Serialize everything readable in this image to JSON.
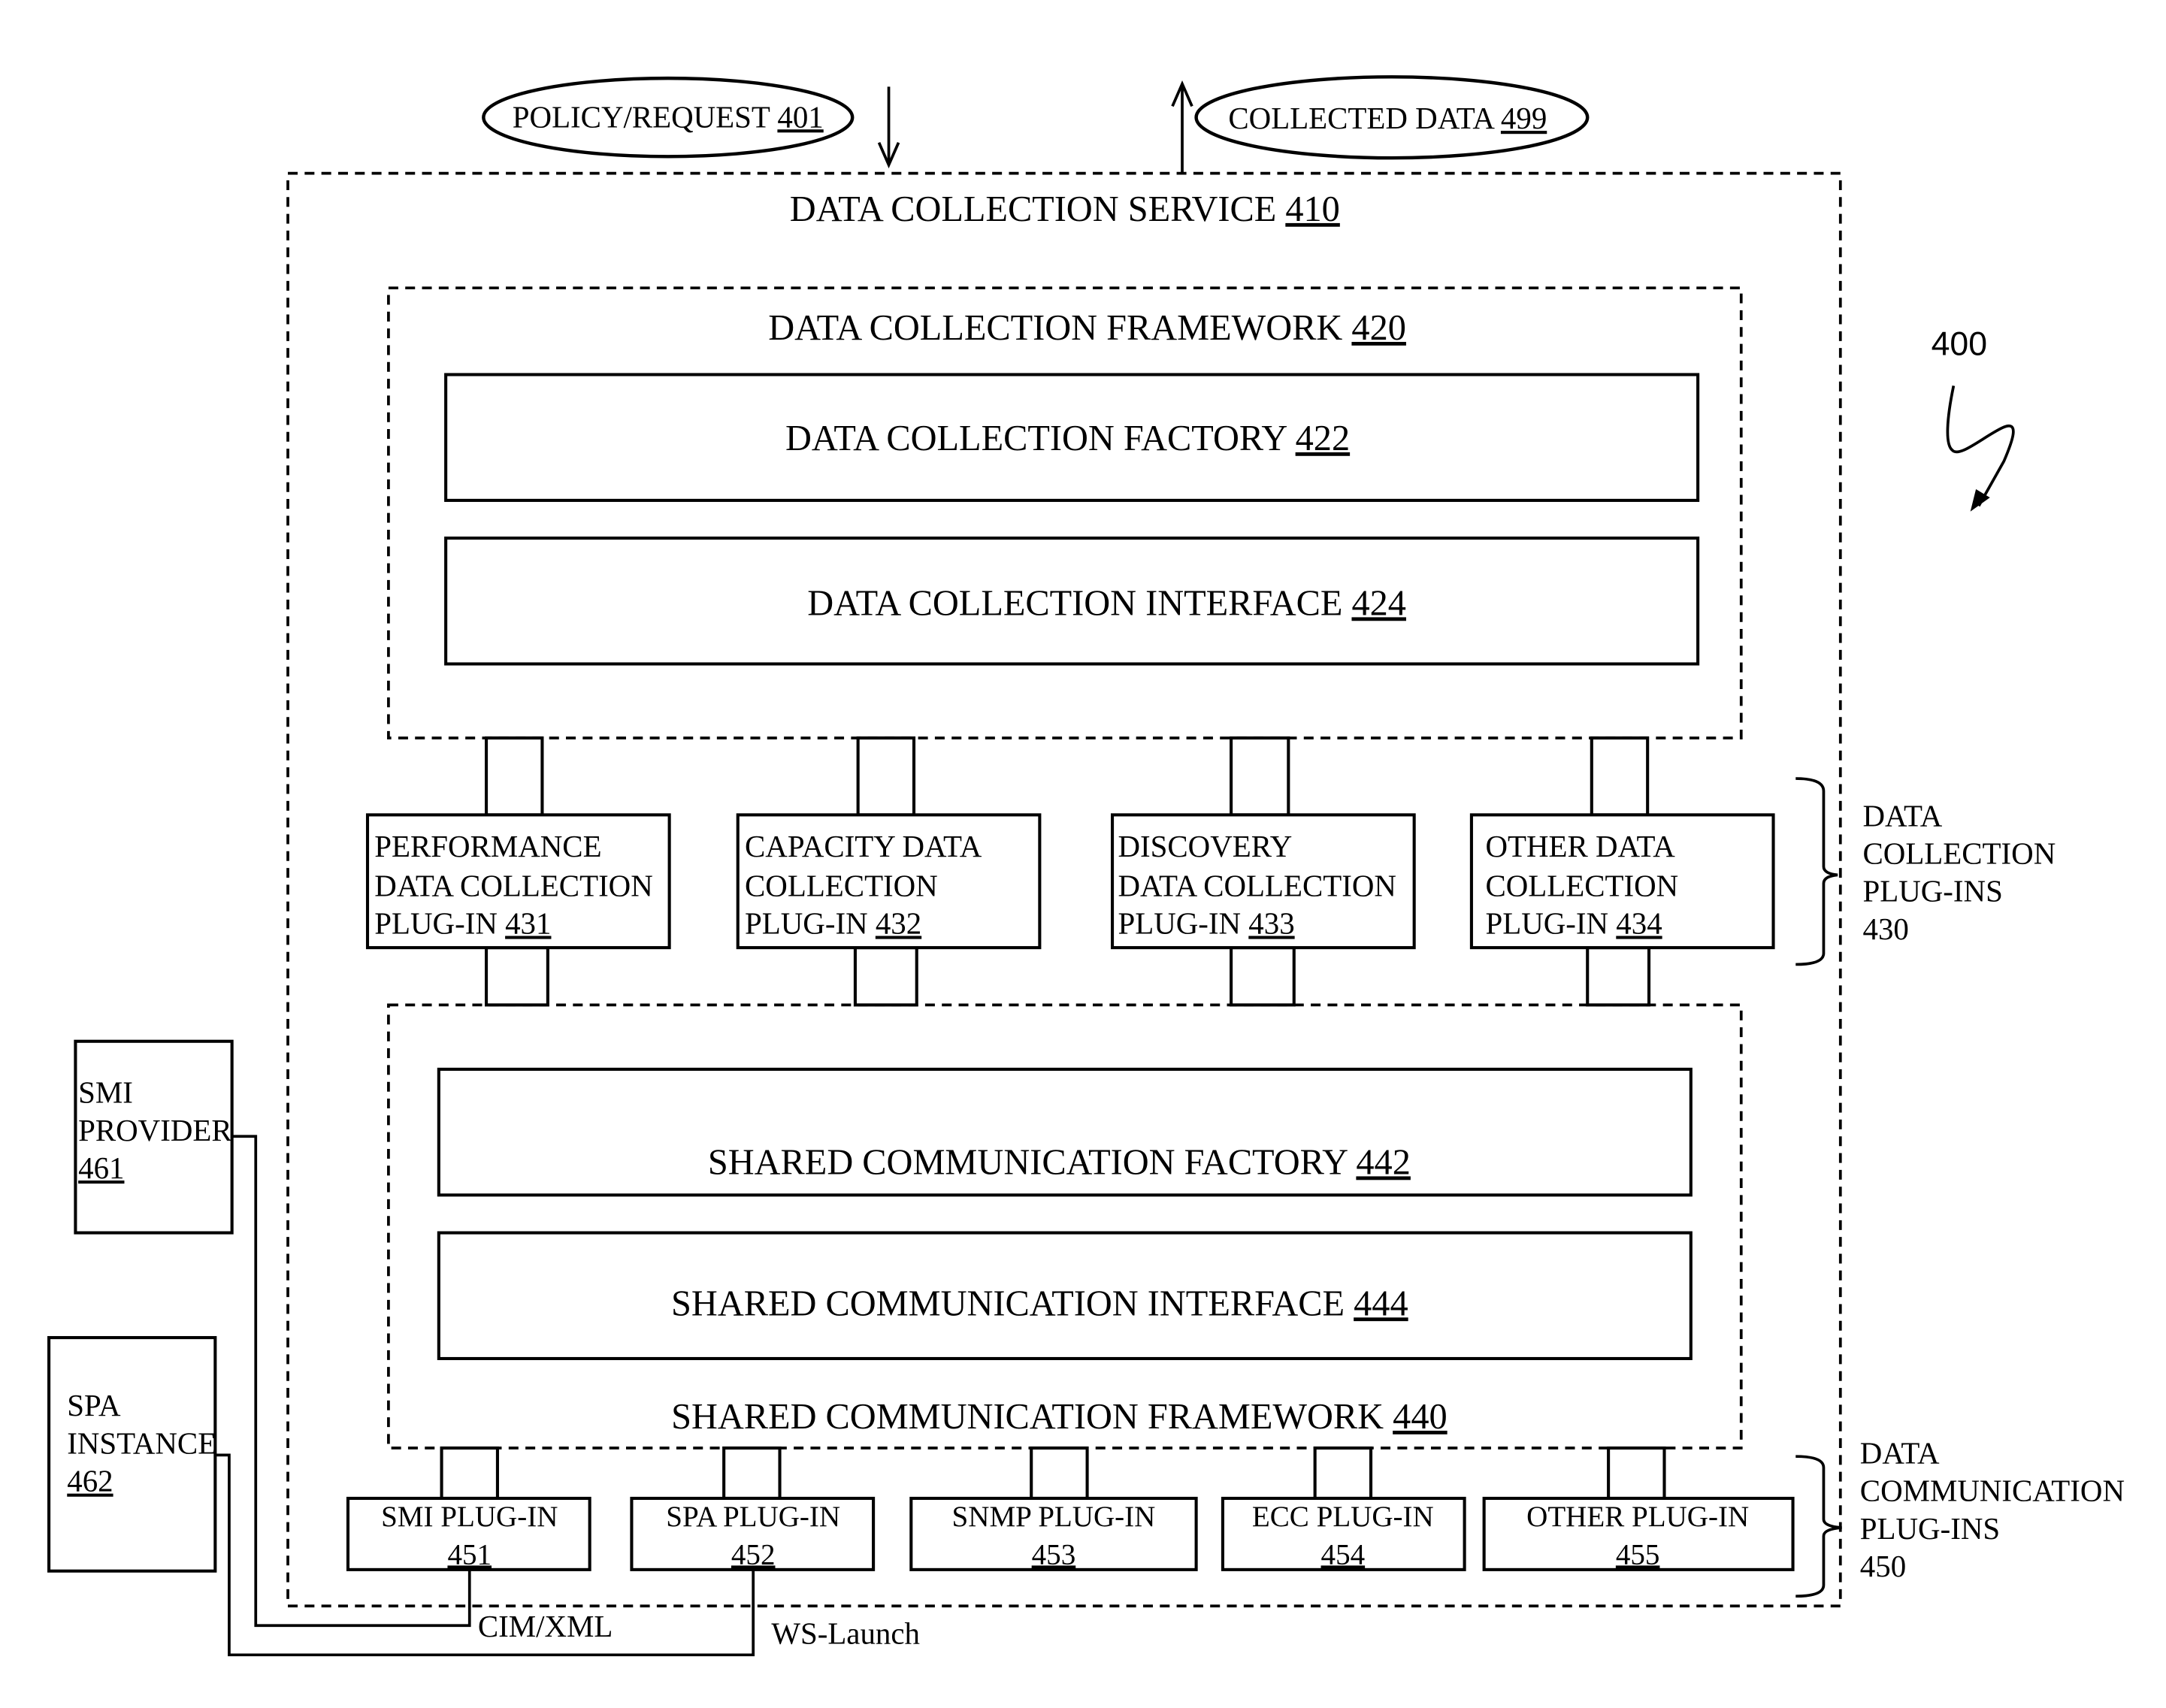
{
  "figure_label": "400",
  "inputs": {
    "policy_request": {
      "text": "POLICY/REQUEST ",
      "ref": "401"
    },
    "collected_data": {
      "text": "COLLECTED DATA ",
      "ref": "499"
    }
  },
  "service": {
    "text": "DATA COLLECTION SERVICE ",
    "ref": "410"
  },
  "collection_framework": {
    "text": "DATA COLLECTION FRAMEWORK ",
    "ref": "420",
    "factory": {
      "text": "DATA COLLECTION FACTORY ",
      "ref": "422"
    },
    "interface": {
      "text": "DATA COLLECTION INTERFACE ",
      "ref": "424"
    }
  },
  "collection_plugins": {
    "group_label": [
      "DATA",
      "COLLECTION",
      "PLUG-INS",
      "430"
    ],
    "items": [
      {
        "lines": [
          "PERFORMANCE",
          "DATA COLLECTION",
          "PLUG-IN "
        ],
        "ref": "431"
      },
      {
        "lines": [
          "CAPACITY DATA",
          "COLLECTION",
          "PLUG-IN "
        ],
        "ref": "432"
      },
      {
        "lines": [
          "DISCOVERY",
          "DATA COLLECTION",
          "PLUG-IN "
        ],
        "ref": "433"
      },
      {
        "lines": [
          "OTHER DATA",
          "COLLECTION",
          "PLUG-IN "
        ],
        "ref": "434"
      }
    ]
  },
  "communication_framework": {
    "text": "SHARED COMMUNICATION FRAMEWORK ",
    "ref": "440",
    "factory": {
      "text": "SHARED COMMUNICATION FACTORY ",
      "ref": "442"
    },
    "interface": {
      "text": "SHARED COMMUNICATION INTERFACE ",
      "ref": "444"
    }
  },
  "communication_plugins": {
    "group_label": [
      "DATA",
      "COMMUNICATION",
      "PLUG-INS",
      "450"
    ],
    "items": [
      {
        "label": "SMI PLUG-IN",
        "ref": "451"
      },
      {
        "label": "SPA PLUG-IN",
        "ref": "452"
      },
      {
        "label": "SNMP PLUG-IN",
        "ref": "453"
      },
      {
        "label": "ECC PLUG-IN",
        "ref": "454"
      },
      {
        "label": "OTHER PLUG-IN",
        "ref": "455"
      }
    ]
  },
  "external": {
    "smi_provider": {
      "lines": [
        "SMI",
        "PROVIDER"
      ],
      "ref": "461"
    },
    "spa_instance": {
      "lines": [
        "SPA",
        "INSTANCE"
      ],
      "ref": "462"
    }
  },
  "protocols": {
    "cim_xml": "CIM/XML",
    "ws_launch": "WS-Launch"
  }
}
